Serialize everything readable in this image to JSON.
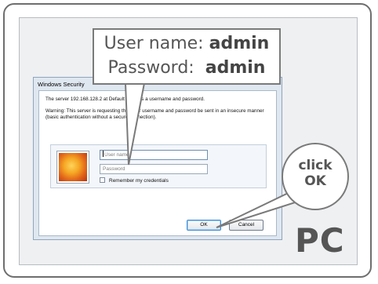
{
  "dialog": {
    "title": "Windows Security",
    "message_line1": "The server 192.168.128.2 at Default requires a username and password.",
    "message_line2": "Warning: This server is requesting that your username and password be sent in an insecure manner (basic authentication without a secure connection).",
    "username_placeholder": "User name",
    "password_placeholder": "Password",
    "remember_label": "Remember my credentials",
    "ok_label": "OK",
    "cancel_label": "Cancel"
  },
  "callout": {
    "username_label": "User name:",
    "username_value": "admin",
    "password_label": "Password:",
    "password_value": "admin"
  },
  "hint": {
    "line1": "click",
    "line2": "OK"
  },
  "device_label": "PC"
}
